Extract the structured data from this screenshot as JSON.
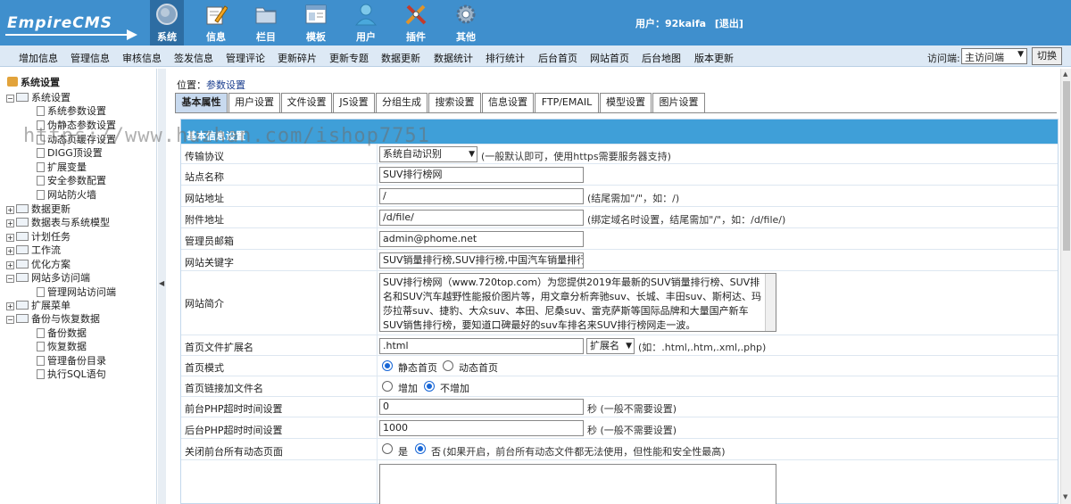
{
  "header": {
    "logo": "EmpireCMS",
    "nav": [
      {
        "label": "系统",
        "icon": "system-globe-icon",
        "active": true
      },
      {
        "label": "信息",
        "icon": "info-pencil-icon"
      },
      {
        "label": "栏目",
        "icon": "column-folder-icon"
      },
      {
        "label": "模板",
        "icon": "template-window-icon"
      },
      {
        "label": "用户",
        "icon": "user-person-icon"
      },
      {
        "label": "插件",
        "icon": "plugin-tools-icon"
      },
      {
        "label": "其他",
        "icon": "other-gear-icon"
      }
    ],
    "user_label": "用户：92kaifa",
    "logout": "[退出]"
  },
  "submenu": {
    "items": [
      "增加信息",
      "管理信息",
      "审核信息",
      "签发信息",
      "管理评论",
      "更新碎片",
      "更新专题",
      "数据更新",
      "数据统计",
      "排行统计",
      "后台首页",
      "网站首页",
      "后台地图",
      "版本更新"
    ],
    "access_label": "访问端:",
    "access_value": "主访问端",
    "switch_label": "切换"
  },
  "sidebar": {
    "title": "系统设置",
    "tree": [
      {
        "label": "系统设置",
        "level": 0,
        "type": "folder",
        "expanded": true
      },
      {
        "label": "系统参数设置",
        "level": 1,
        "type": "doc"
      },
      {
        "label": "伪静态参数设置",
        "level": 1,
        "type": "doc"
      },
      {
        "label": "动态页缓存设置",
        "level": 1,
        "type": "doc"
      },
      {
        "label": "DIGG顶设置",
        "level": 1,
        "type": "doc"
      },
      {
        "label": "扩展变量",
        "level": 1,
        "type": "doc"
      },
      {
        "label": "安全参数配置",
        "level": 1,
        "type": "doc"
      },
      {
        "label": "网站防火墙",
        "level": 1,
        "type": "doc"
      },
      {
        "label": "数据更新",
        "level": 0,
        "type": "folder",
        "expanded": false
      },
      {
        "label": "数据表与系统模型",
        "level": 0,
        "type": "folder",
        "expanded": false
      },
      {
        "label": "计划任务",
        "level": 0,
        "type": "folder",
        "expanded": false
      },
      {
        "label": "工作流",
        "level": 0,
        "type": "folder",
        "expanded": false
      },
      {
        "label": "优化方案",
        "level": 0,
        "type": "folder",
        "expanded": false
      },
      {
        "label": "网站多访问端",
        "level": 0,
        "type": "folder",
        "expanded": true
      },
      {
        "label": "管理网站访问端",
        "level": 1,
        "type": "doc"
      },
      {
        "label": "扩展菜单",
        "level": 0,
        "type": "folder",
        "expanded": false
      },
      {
        "label": "备份与恢复数据",
        "level": 0,
        "type": "folder",
        "expanded": true
      },
      {
        "label": "备份数据",
        "level": 1,
        "type": "doc"
      },
      {
        "label": "恢复数据",
        "level": 1,
        "type": "doc"
      },
      {
        "label": "管理备份目录",
        "level": 1,
        "type": "doc"
      },
      {
        "label": "执行SQL语句",
        "level": 1,
        "type": "doc"
      }
    ]
  },
  "main": {
    "location_prefix": "位置：",
    "location_link": "参数设置",
    "tabs": [
      "基本属性",
      "用户设置",
      "文件设置",
      "JS设置",
      "分组生成",
      "搜索设置",
      "信息设置",
      "FTP/EMAIL",
      "模型设置",
      "图片设置"
    ],
    "active_tab": "基本属性",
    "panel_title": "基本信息设置",
    "form": {
      "protocol": {
        "label": "传输协议",
        "value": "系统自动识别",
        "note": "(一般默认即可，使用https需要服务器支持)"
      },
      "site_name": {
        "label": "站点名称",
        "value": "SUV排行榜网"
      },
      "site_url": {
        "label": "网站地址",
        "value": "/",
        "note": "(结尾需加\"/\"，如：/)"
      },
      "file_url": {
        "label": "附件地址",
        "value": "/d/file/",
        "note": "(绑定域名时设置，结尾需加\"/\"，如：/d/file/)"
      },
      "admin_email": {
        "label": "管理员邮箱",
        "value": "admin@phome.net"
      },
      "keywords": {
        "label": "网站关键字",
        "value": "SUV销量排行榜,SUV排行榜,中国汽车销量排行榜"
      },
      "description": {
        "label": "网站简介",
        "value": "SUV排行榜网（www.720top.com）为您提供2019年最新的SUV销量排行榜、SUV排名和SUV汽车越野性能报价图片等，用文章分析奔驰suv、长城、丰田suv、斯柯达、玛莎拉蒂suv、捷豹、大众suv、本田、尼桑suv、雷克萨斯等国际品牌和大量国产新车SUV销售排行榜，要知道口碑最好的suv车排名来SUV排行榜网走一波。"
      },
      "index_ext": {
        "label": "首页文件扩展名",
        "value": ".html",
        "select": "扩展名",
        "note": "(如：.html,.htm,.xml,.php)"
      },
      "index_mode": {
        "label": "首页模式",
        "options": [
          "静态首页",
          "动态首页"
        ],
        "selected": "静态首页"
      },
      "index_link": {
        "label": "首页链接加文件名",
        "options": [
          "增加",
          "不增加"
        ],
        "selected": "不增加"
      },
      "front_timeout": {
        "label": "前台PHP超时时间设置",
        "value": "0",
        "note": "秒 (一般不需要设置)"
      },
      "back_timeout": {
        "label": "后台PHP超时时间设置",
        "value": "1000",
        "note": "秒 (一般不需要设置)"
      },
      "close_dynamic": {
        "label": "关闭前台所有动态页面",
        "options": [
          "是",
          "否"
        ],
        "selected": "否",
        "note": "(如果开启，前台所有动态文件都无法使用，但性能和安全性最高)"
      }
    }
  },
  "watermark": "https://www.huzhan.com/ishop7751",
  "colors": {
    "header": "#3f8fcd",
    "submenu": "#dde9f5",
    "panel_head": "#3f9fd8",
    "active_tab": "#c8daef"
  }
}
